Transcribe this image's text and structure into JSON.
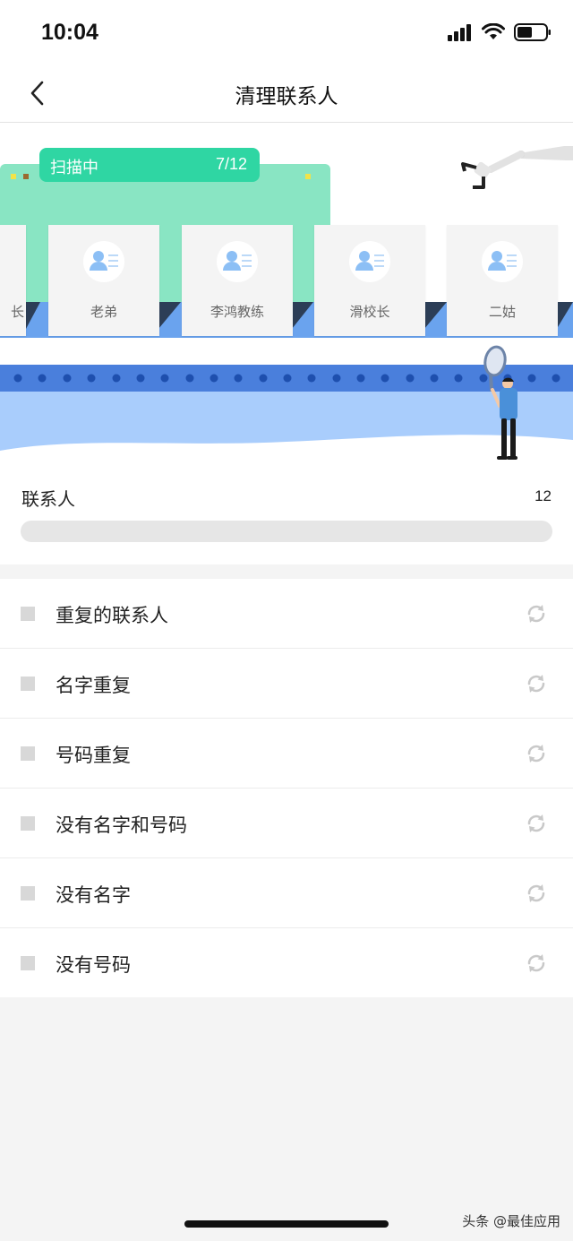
{
  "status": {
    "time": "10:04"
  },
  "nav": {
    "title": "清理联系人"
  },
  "scan": {
    "label": "扫描中",
    "progress": "7/12"
  },
  "cards": [
    {
      "name": "长"
    },
    {
      "name": "老弟"
    },
    {
      "name": "李鸿教练"
    },
    {
      "name": "滑校长"
    },
    {
      "name": "二姑"
    }
  ],
  "summary": {
    "label": "联系人",
    "count": "12",
    "progress_fraction": 0.0
  },
  "categories": [
    {
      "label": "重复的联系人"
    },
    {
      "label": "名字重复"
    },
    {
      "label": "号码重复"
    },
    {
      "label": "没有名字和号码"
    },
    {
      "label": "没有名字"
    },
    {
      "label": "没有号码"
    }
  ],
  "watermark": "头条 @最佳应用",
  "colors": {
    "accent": "#2fd6a3",
    "belt_blue": "#4a7fdc",
    "wave_blue": "#a9cdfc"
  }
}
